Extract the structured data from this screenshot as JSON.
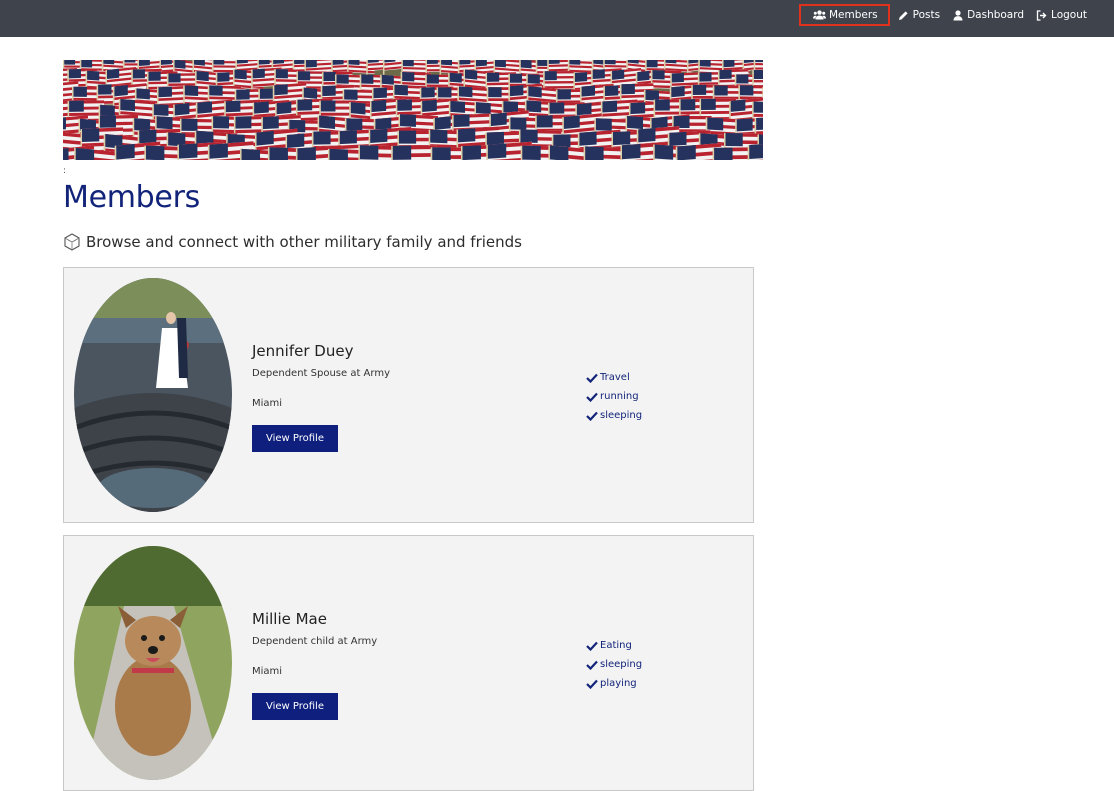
{
  "nav": {
    "items": [
      {
        "label": "Members",
        "icon": "users-icon",
        "active": true
      },
      {
        "label": "Posts",
        "icon": "pencil-icon"
      },
      {
        "label": "Dashboard",
        "icon": "user-icon"
      },
      {
        "label": "Logout",
        "icon": "logout-icon"
      }
    ]
  },
  "page": {
    "colon": ":",
    "title": "Members",
    "subtitle": "Browse and connect with other military family and friends"
  },
  "members": [
    {
      "name": "Jennifer Duey",
      "role": "Dependent Spouse at Army",
      "city": "Miami",
      "button": "View Profile",
      "interests": [
        "Travel",
        "running",
        "sleeping"
      ]
    },
    {
      "name": "Millie Mae",
      "role": "Dependent child at Army",
      "city": "Miami",
      "button": "View Profile",
      "interests": [
        "Eating",
        "sleeping",
        "playing"
      ]
    }
  ],
  "colors": {
    "navbar": "#3f444c",
    "accent": "#12247a",
    "button": "#0f1f7e",
    "active_outline": "#e0311c"
  }
}
